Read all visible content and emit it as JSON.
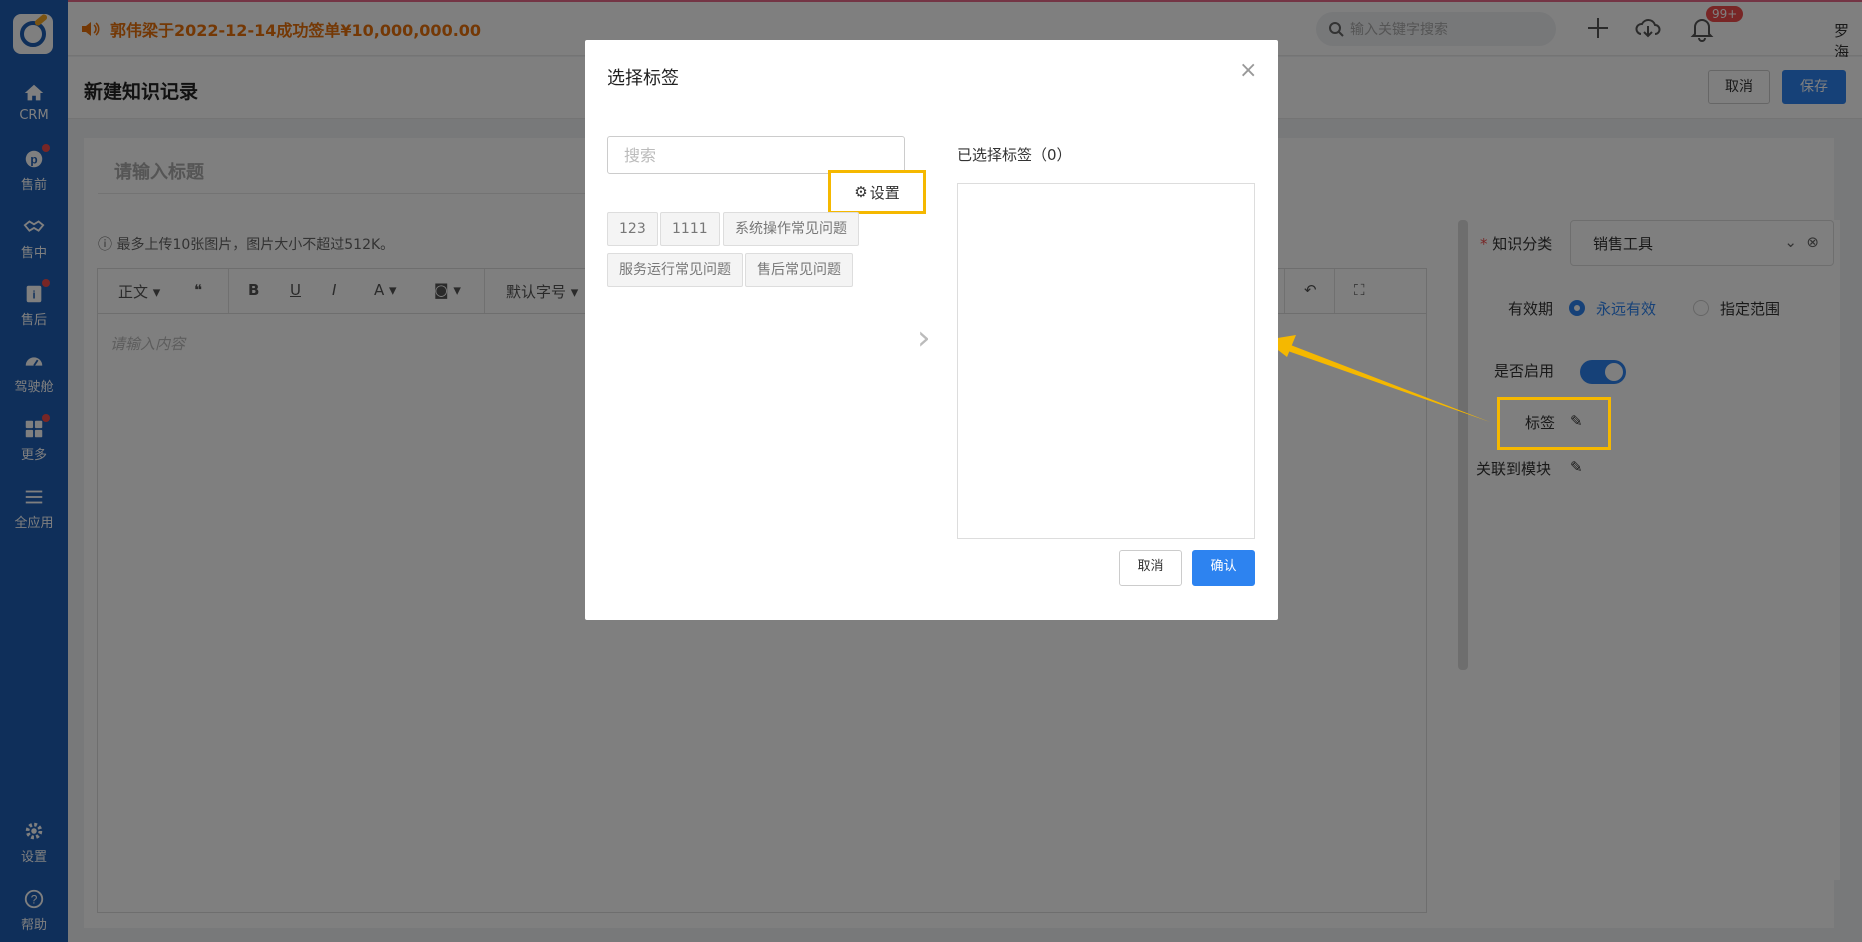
{
  "sidebar": {
    "items": [
      {
        "label": "CRM",
        "icon": "home-icon"
      },
      {
        "label": "售前",
        "icon": "pin-icon"
      },
      {
        "label": "售中",
        "icon": "handshake-icon"
      },
      {
        "label": "售后",
        "icon": "info-icon"
      },
      {
        "label": "驾驶舱",
        "icon": "dashboard-icon"
      },
      {
        "label": "更多",
        "icon": "grid-icon"
      },
      {
        "label": "全应用",
        "icon": "menu-icon"
      },
      {
        "label": "设置",
        "icon": "gear-icon"
      },
      {
        "label": "帮助",
        "icon": "help-icon"
      }
    ]
  },
  "topbar": {
    "announcement": "郭伟梁于2022-12-14成功签单¥10,000,000.00",
    "search_placeholder": "输入关键字搜索",
    "notification_badge": "99+",
    "user_name": "罗海镜"
  },
  "page": {
    "title": "新建知识记录",
    "cancel_label": "取消",
    "save_label": "保存"
  },
  "editor": {
    "title_placeholder": "请输入标题",
    "upload_hint": "最多上传10张图片，图片大小不超过512K。",
    "toolbar": {
      "paragraph": "正文",
      "font_size": "默认字号"
    },
    "content_placeholder": "请输入内容"
  },
  "right_panel": {
    "category_label": "知识分类",
    "category_value": "销售工具",
    "validity_label": "有效期",
    "validity_forever": "永远有效",
    "validity_range": "指定范围",
    "enabled_label": "是否启用",
    "tags_label": "标签",
    "linked_module_label": "关联到模块"
  },
  "modal": {
    "title": "选择标签",
    "search_placeholder": "搜索",
    "settings_label": "设置",
    "tags": [
      "123",
      "1111",
      "系统操作常见问题",
      "服务运行常见问题",
      "售后常见问题"
    ],
    "selected_label": "已选择标签（0）",
    "cancel_label": "取消",
    "confirm_label": "确认"
  }
}
